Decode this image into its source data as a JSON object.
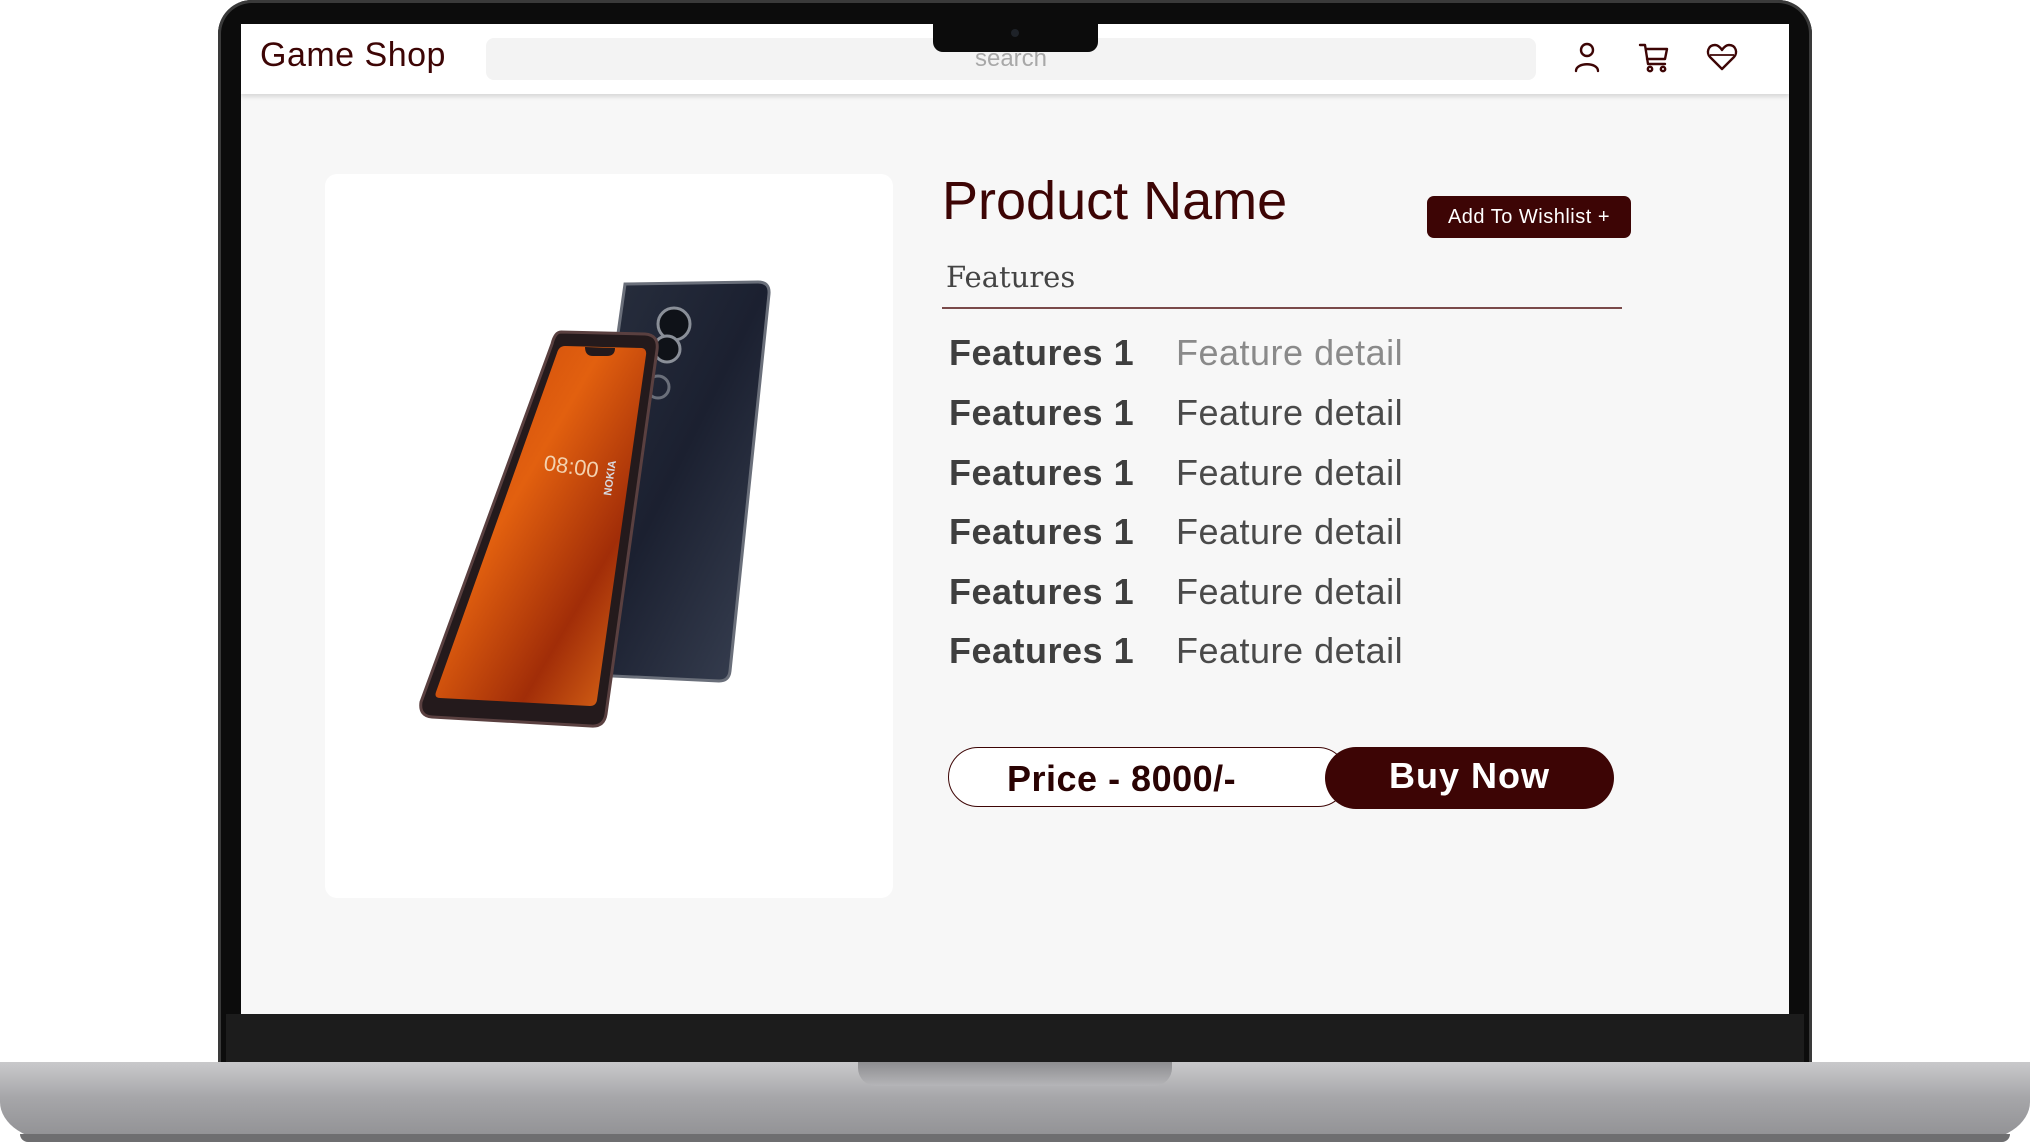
{
  "header": {
    "logo": "Game Shop",
    "search_placeholder": "search",
    "icons": [
      "user-icon",
      "cart-icon",
      "heart-icon"
    ]
  },
  "product": {
    "name": "Product Name",
    "wishlist_label": "Add To Wishlist +",
    "features_title": "Features",
    "features": [
      {
        "name": "Features 1",
        "detail": "Feature detail"
      },
      {
        "name": "Features 1",
        "detail": "Feature detail"
      },
      {
        "name": "Features 1",
        "detail": "Feature detail"
      },
      {
        "name": "Features 1",
        "detail": "Feature detail"
      },
      {
        "name": "Features 1",
        "detail": "Feature detail"
      },
      {
        "name": "Features 1",
        "detail": "Feature detail"
      }
    ],
    "price_label": "Price - 8000/-",
    "buy_label": "Buy Now",
    "phone_screen_time": "08:00",
    "phone_brand": "NOKIA"
  },
  "colors": {
    "brand": "#3d0505",
    "background": "#f7f7f7",
    "surface": "#ffffff"
  }
}
